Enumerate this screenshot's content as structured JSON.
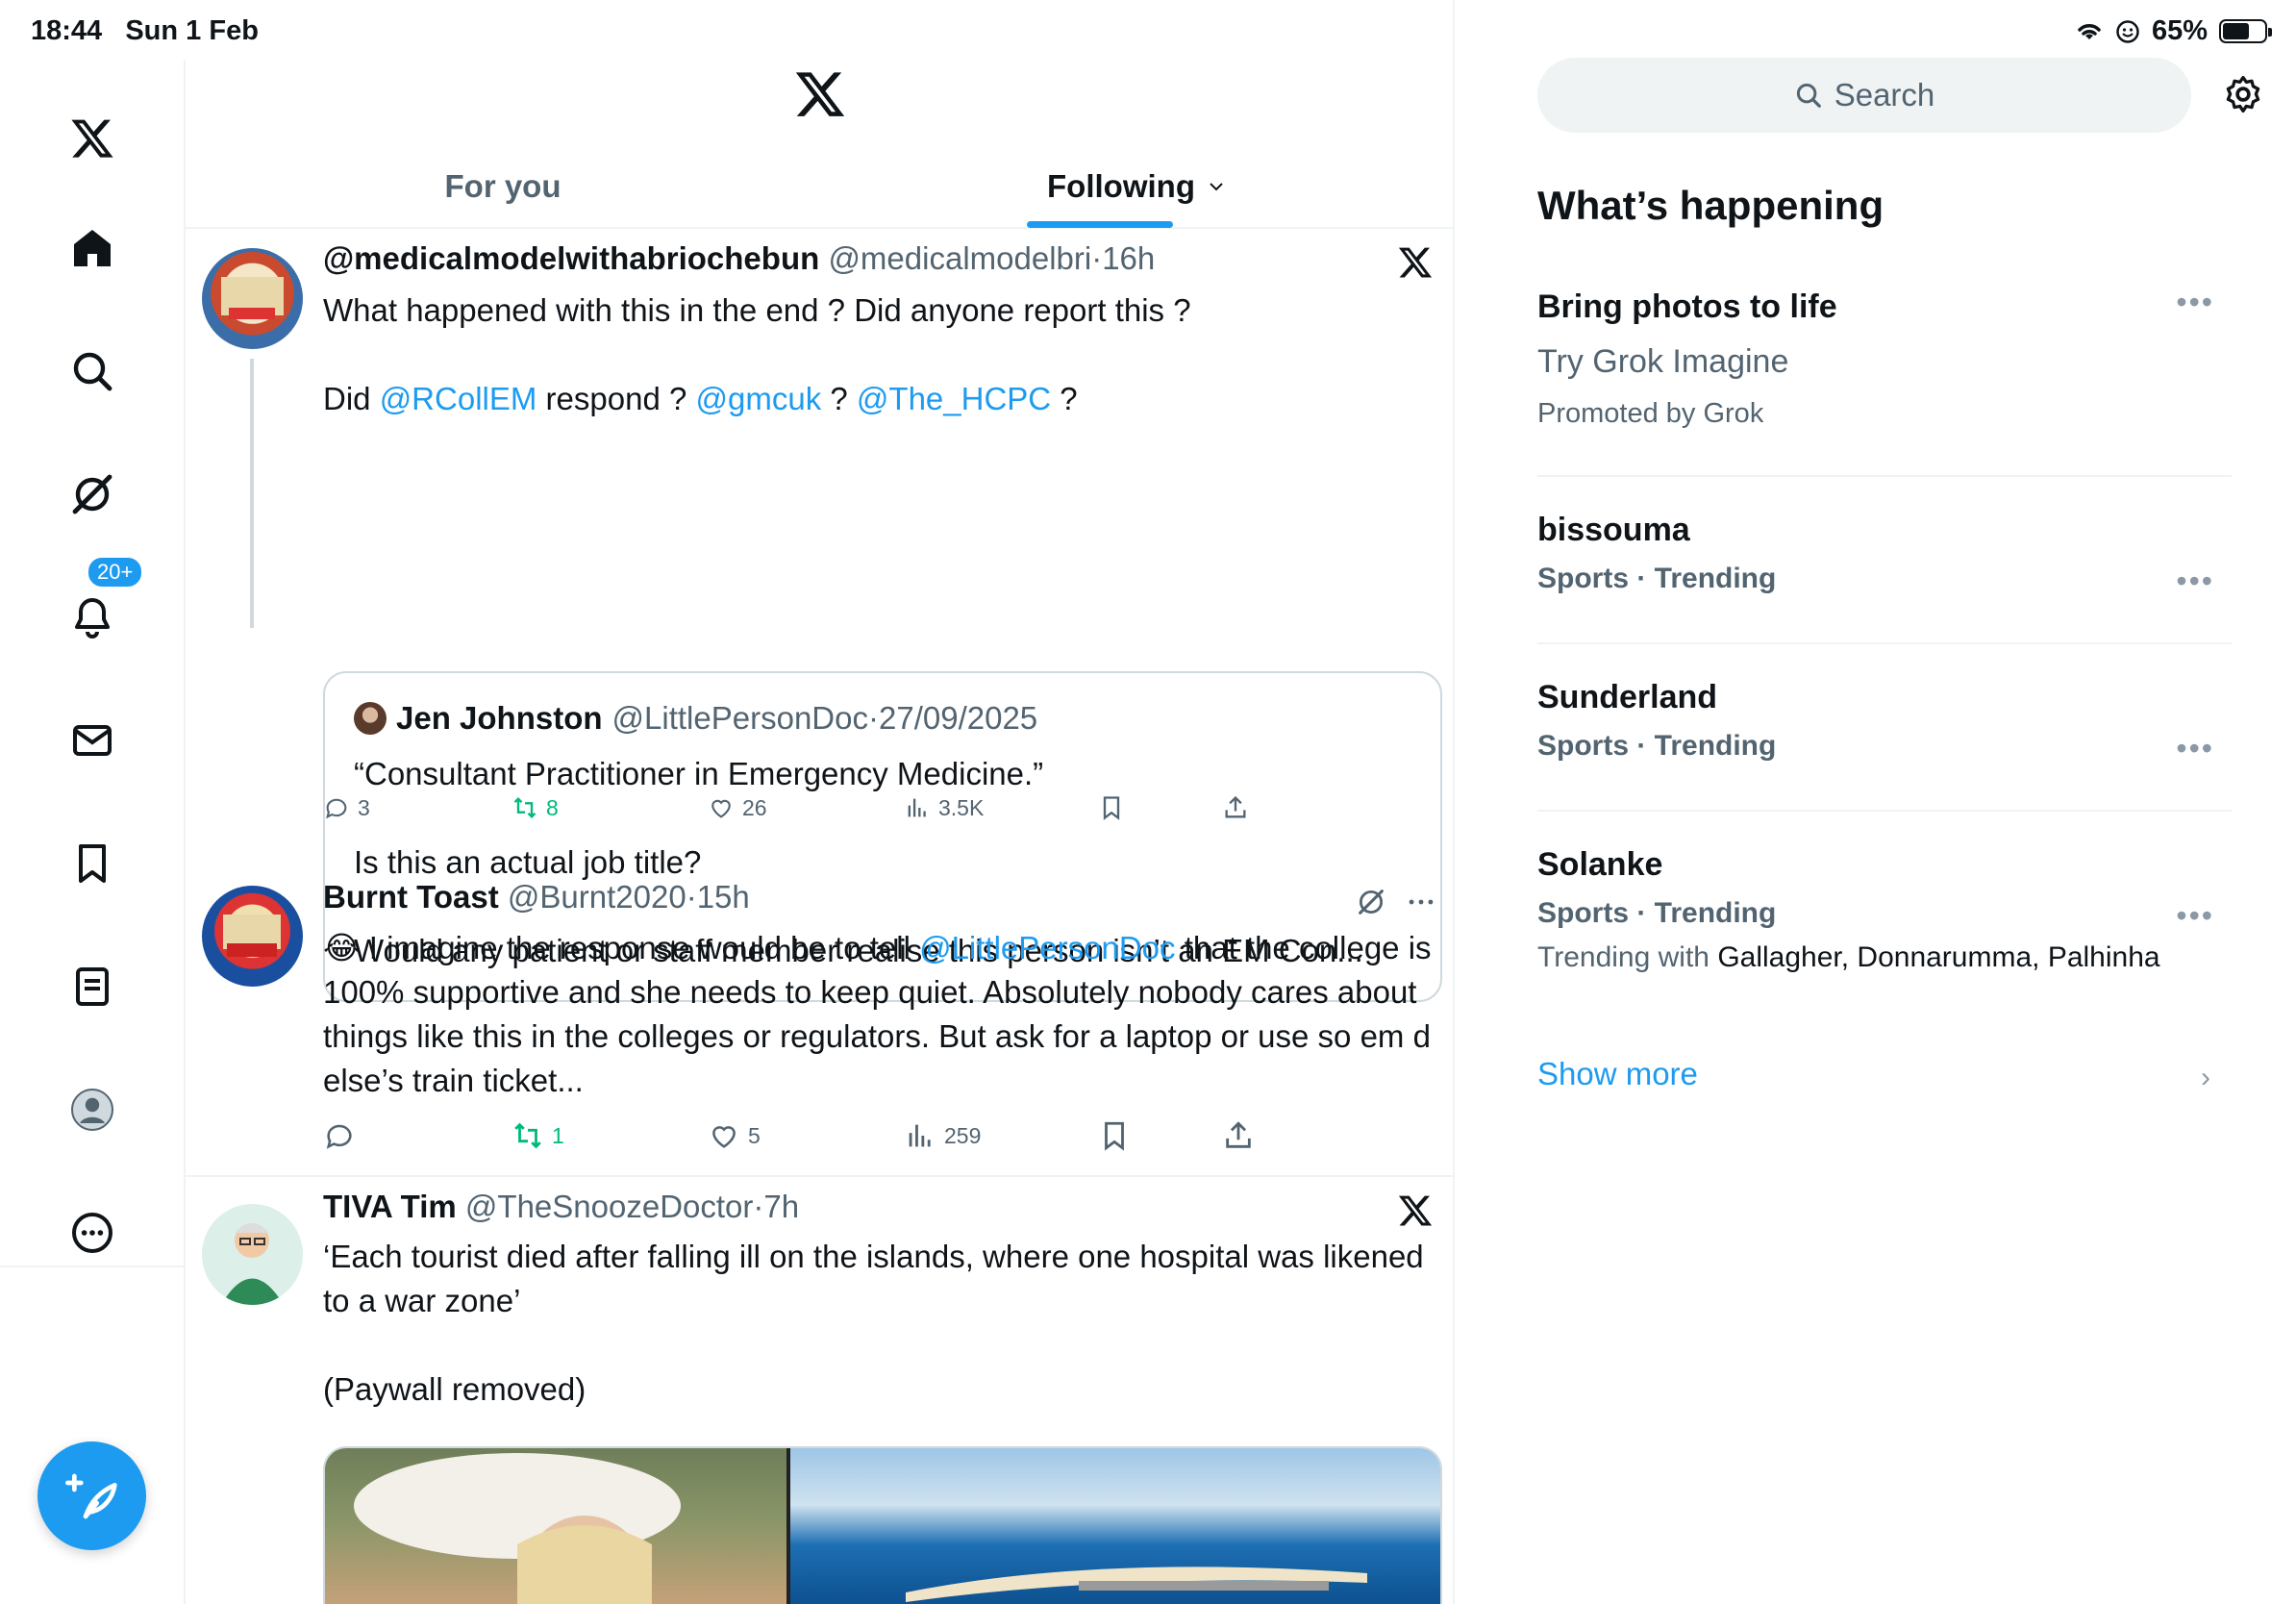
{
  "status_bar": {
    "time": "18:44",
    "date": "Sun 1 Feb",
    "battery": "65%",
    "battery_level": 0.65
  },
  "nav": {
    "items": [
      "x-logo",
      "home",
      "search",
      "grok",
      "notifications",
      "messages",
      "bookmarks",
      "lists",
      "profile",
      "more"
    ],
    "notifications_badge": "20+"
  },
  "tabs": {
    "for_you": "For you",
    "following": "Following",
    "active": "following"
  },
  "tweets": [
    {
      "name": "@medicalmodelwithabriochebun",
      "handle": "@medicalmodelbri",
      "time": "16h",
      "body_line1": "What happened with this in the end ? Did anyone report this ?",
      "body_line2_prefix": "Did ",
      "mention1": "@RCollEM",
      "body_line2_mid1": " respond ? ",
      "mention2": "@gmcuk",
      "body_line2_mid2": " ? ",
      "mention3": "@The_HCPC",
      "body_line2_suffix": " ?",
      "quote": {
        "name": "Jen Johnston",
        "handle": "@LittlePersonDoc",
        "date": "27/09/2025",
        "line1": "“Consultant Practitioner in Emergency Medicine.”",
        "line2": "Is this an actual job title?",
        "line3": "Would any patient or staff member realise this person isn’t an EM Con..."
      },
      "replies": "3",
      "reposts": "8",
      "likes": "26",
      "views": "3.5K"
    },
    {
      "name": "Burnt Toast",
      "handle": "@Burnt2020",
      "time": "15h",
      "emoji": "😂",
      "body_prefix": " I imagine the response would be to tell ",
      "mention": "@LittlePersonDoc",
      "body_suffix": " that the college is 100% supportive and she needs to keep quiet. Absolutely nobody cares about things like this in the colleges or regulators. But ask for a laptop or use so em d else’s train ticket...",
      "replies": "",
      "reposts": "1",
      "likes": "5",
      "views": "259"
    },
    {
      "name": "TIVA Tim",
      "handle": "@TheSnoozeDoctor",
      "time": "7h",
      "body_line1": "‘Each tourist died after falling ill on the islands, where one hospital was likened to a war zone’",
      "body_line2": "(Paywall removed)"
    }
  ],
  "sidebar": {
    "search_placeholder": "Search",
    "title": "What’s happening",
    "trends": [
      {
        "name": "Bring photos to life",
        "sub": "Try Grok Imagine",
        "meta": "Promoted by Grok"
      },
      {
        "name": "bissouma",
        "sub": "Sports · Trending"
      },
      {
        "name": "Sunderland",
        "sub": "Sports · Trending"
      },
      {
        "name": "Solanke",
        "sub": "Sports · Trending",
        "with_label": "Trending with ",
        "with_names": "Gallagher, Donnarumma, Palhinha"
      }
    ],
    "show_more": "Show more"
  },
  "colors": {
    "accent": "#1d9bf0",
    "repost_green": "#00ba7c",
    "text": "#0f1419",
    "muted": "#536471"
  }
}
